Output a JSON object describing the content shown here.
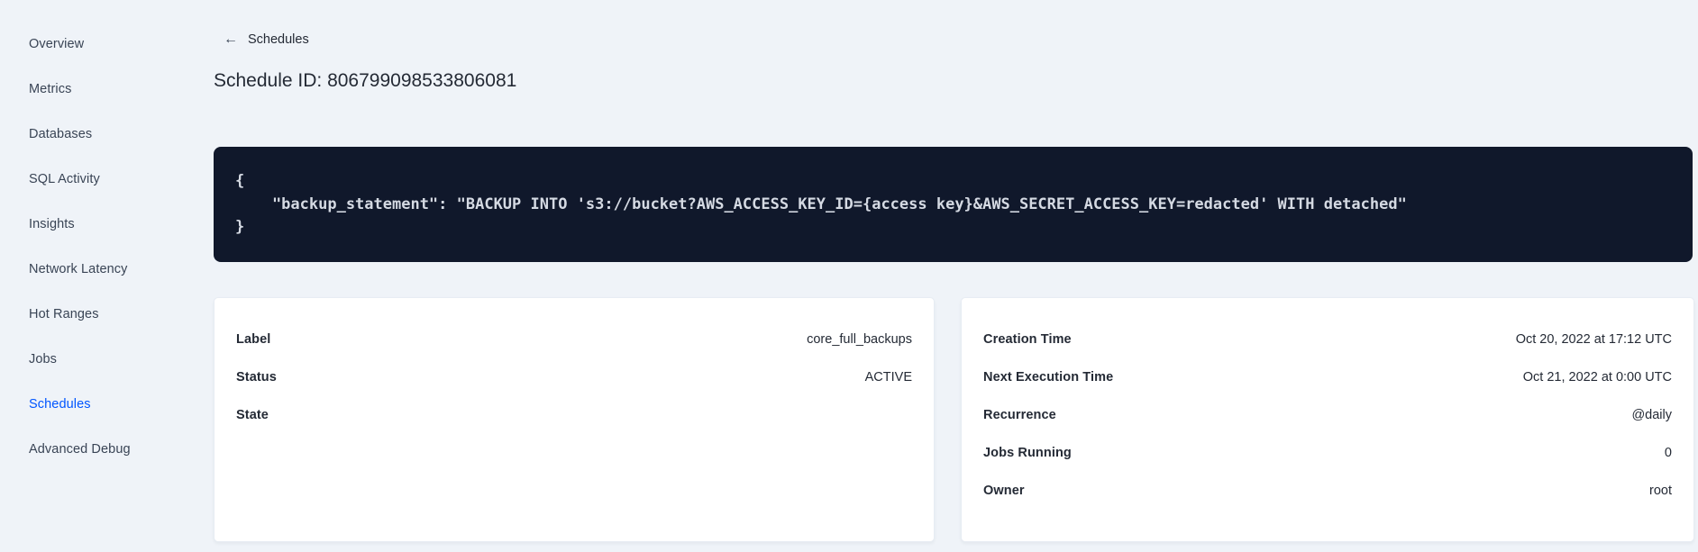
{
  "sidebar": {
    "items": [
      {
        "label": "Overview",
        "active": false
      },
      {
        "label": "Metrics",
        "active": false
      },
      {
        "label": "Databases",
        "active": false
      },
      {
        "label": "SQL Activity",
        "active": false
      },
      {
        "label": "Insights",
        "active": false
      },
      {
        "label": "Network Latency",
        "active": false
      },
      {
        "label": "Hot Ranges",
        "active": false
      },
      {
        "label": "Jobs",
        "active": false
      },
      {
        "label": "Schedules",
        "active": true
      },
      {
        "label": "Advanced Debug",
        "active": false
      }
    ]
  },
  "header": {
    "back_icon": "←",
    "back_label": "Schedules",
    "title": "Schedule ID: 806799098533806081"
  },
  "code_block": {
    "lines": [
      "{",
      "    \"backup_statement\": \"BACKUP INTO 's3://bucket?AWS_ACCESS_KEY_ID={access key}&AWS_SECRET_ACCESS_KEY=redacted' WITH detached\"",
      "}"
    ]
  },
  "details_card": {
    "rows": [
      {
        "label": "Label",
        "value": "core_full_backups"
      },
      {
        "label": "Status",
        "value": "ACTIVE"
      },
      {
        "label": "State",
        "value": ""
      }
    ]
  },
  "schedule_card": {
    "rows": [
      {
        "label": "Creation Time",
        "value": "Oct 20, 2022 at 17:12 UTC"
      },
      {
        "label": "Next Execution Time",
        "value": "Oct 21, 2022 at 0:00 UTC"
      },
      {
        "label": "Recurrence",
        "value": "@daily"
      },
      {
        "label": "Jobs Running",
        "value": "0"
      },
      {
        "label": "Owner",
        "value": "root"
      }
    ]
  },
  "colors": {
    "page_bg": "#eff3f8",
    "accent_blue": "#0055ff",
    "text_dark": "#242a35",
    "sidebar_text": "#394455",
    "code_bg": "#10182b",
    "code_text": "#d5dae3",
    "card_border": "#e7ecf3",
    "card_bg": "#ffffff"
  }
}
